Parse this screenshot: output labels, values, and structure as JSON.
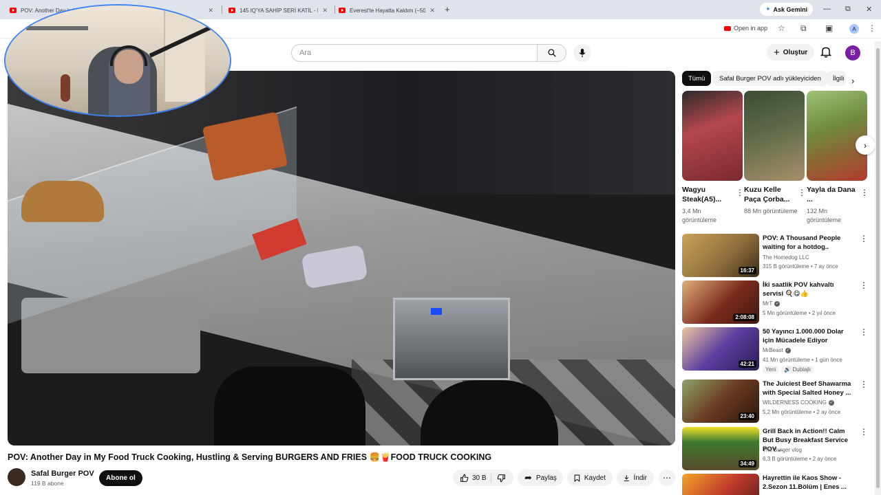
{
  "browser": {
    "tabs": [
      {
        "title": "POV: Another Day in My Food Truck"
      },
      {
        "title": "145 IQ'YA SAHİP SERİ KATİL - El"
      },
      {
        "title": "Everest'te Hayatta Kaldım (−50"
      }
    ],
    "new_tab": "+",
    "ask_gemini": "Ask Gemini",
    "open_in_app": "Open in app",
    "profile_initial": "A",
    "window_controls": {
      "minimize": "—",
      "maximize": "⧉",
      "close": "✕"
    }
  },
  "header": {
    "search_placeholder": "Ara",
    "create_label": "Oluştur",
    "avatar_initial": "B"
  },
  "video": {
    "title": "POV: Another Day in My Food Truck Cooking, Hustling & Serving BURGERS AND FRIES 🍔🍟FOOD TRUCK COOKING",
    "channel": "Safal Burger POV",
    "subscribers": "119 B abone",
    "subscribe_label": "Abone ol",
    "likes": "30 B",
    "share_label": "Paylaş",
    "save_label": "Kaydet",
    "download_label": "İndir"
  },
  "chips": [
    {
      "label": "Tümü",
      "active": true
    },
    {
      "label": "Safal Burger POV adlı yükleyiciden",
      "active": false
    },
    {
      "label": "İlgili",
      "active": false
    }
  ],
  "shorts": [
    {
      "title": "Wagyu Steak(A5)...",
      "views": "3,4 Mn görüntüleme",
      "color": "#b4474d"
    },
    {
      "title": "Kuzu Kelle Paça Çorba...",
      "views": "88 Mn görüntüleme",
      "color": "#5e6b4a"
    },
    {
      "title": "Yayla da Dana ...",
      "views": "132 Mn görüntüleme",
      "color": "#6f8b3e"
    }
  ],
  "recommendations": [
    {
      "title": "POV: A Thousand People waiting for a hotdog..",
      "channel": "The Homedog LLC",
      "verified": false,
      "meta": "315 B görüntüleme • 7 ay önce",
      "duration": "16:37",
      "color": "#8a6a3a"
    },
    {
      "title": "İki saatlik POV kahvaltı servisi 🍳😋👍",
      "channel": "MrT",
      "verified": true,
      "meta": "5 Mn görüntüleme • 2 yıl önce",
      "duration": "2:08:08",
      "color": "#7a2a1c"
    },
    {
      "title": "50 Yayıncı 1.000.000 Dolar için Mücadele Ediyor",
      "channel": "MrBeast",
      "verified": true,
      "meta": "41 Mn görüntüleme • 1 gün önce",
      "duration": "42:21",
      "color": "#5b3fa0",
      "badges": [
        "Yeni",
        "Dublajlı"
      ]
    },
    {
      "title": "The Juiciest Beef Shawarma with Special Salted Honey ...",
      "channel": "WILDERNESS COOKING",
      "verified": true,
      "meta": "5,2 Mn görüntüleme • 2 ay önce",
      "duration": "23:40",
      "color": "#6b3b22"
    },
    {
      "title": "Grill Back in Action!! Calm But Busy Breakfast Service POV ...",
      "channel": "The Burger vlog",
      "verified": false,
      "meta": "6,3 B görüntüleme • 2 ay önce",
      "duration": "34:49",
      "color": "#3c7a2f"
    },
    {
      "title": "Hayrettin ile Kaos Show - 2.Sezon 11.Bölüm | Enes ...",
      "channel": "",
      "verified": false,
      "meta": "",
      "duration": "",
      "color": "#c0392b"
    }
  ]
}
